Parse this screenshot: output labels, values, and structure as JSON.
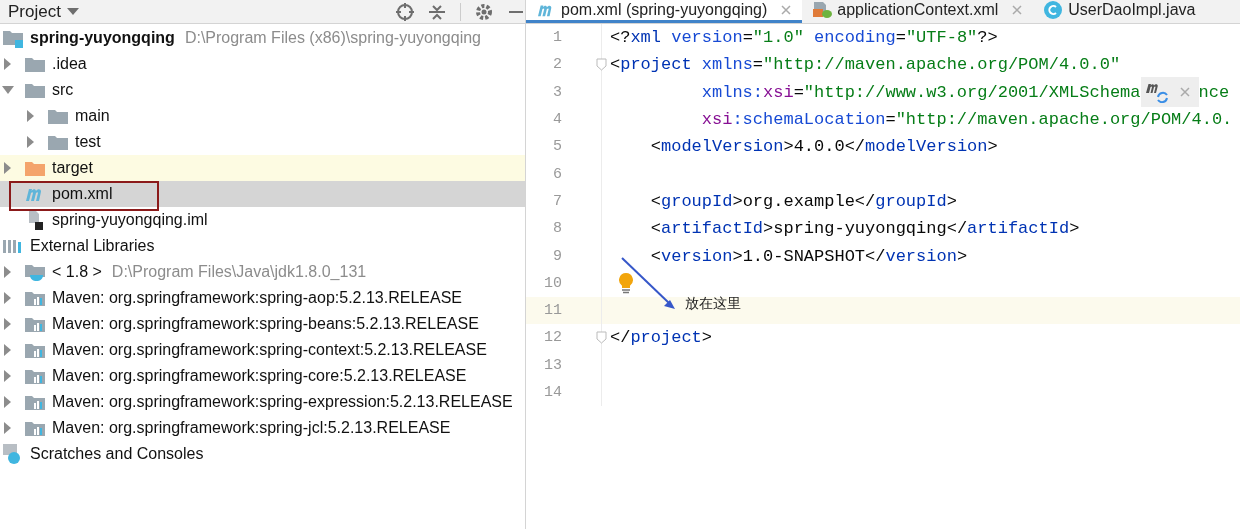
{
  "project_panel": {
    "title": "Project"
  },
  "tree": [
    {
      "label": "spring-yuyongqing",
      "kind": "module",
      "hint": "D:\\Program Files (x86)\\spring-yuyongqing",
      "selected": false,
      "children": [
        {
          "label": ".idea",
          "kind": "folder",
          "expanded": false,
          "selected": false
        },
        {
          "label": "src",
          "kind": "folder",
          "expanded": true,
          "selected": false,
          "children": [
            {
              "label": "main",
              "kind": "folder",
              "expanded": false,
              "selected": false
            },
            {
              "label": "test",
              "kind": "folder",
              "expanded": false,
              "selected": false
            }
          ]
        },
        {
          "label": "target",
          "kind": "excluded-folder",
          "expanded": false,
          "selected": false,
          "highlighted": true
        },
        {
          "label": "pom.xml",
          "kind": "maven",
          "selected": true,
          "outlined": true
        },
        {
          "label": "spring-yuyongqing.iml",
          "kind": "iml",
          "selected": false
        }
      ]
    },
    {
      "label": "External Libraries",
      "kind": "libraries",
      "selected": false,
      "children": [
        {
          "label": "< 1.8 >",
          "kind": "jdk",
          "hint": "D:\\Program Files\\Java\\jdk1.8.0_131",
          "expanded": false,
          "selected": false
        },
        {
          "label": "Maven: org.springframework:spring-aop:5.2.13.RELEASE",
          "kind": "library",
          "expanded": false,
          "selected": false
        },
        {
          "label": "Maven: org.springframework:spring-beans:5.2.13.RELEASE",
          "kind": "library",
          "expanded": false,
          "selected": false
        },
        {
          "label": "Maven: org.springframework:spring-context:5.2.13.RELEASE",
          "kind": "library",
          "expanded": false,
          "selected": false
        },
        {
          "label": "Maven: org.springframework:spring-core:5.2.13.RELEASE",
          "kind": "library",
          "expanded": false,
          "selected": false
        },
        {
          "label": "Maven: org.springframework:spring-expression:5.2.13.RELEASE",
          "kind": "library",
          "expanded": false,
          "selected": false
        },
        {
          "label": "Maven: org.springframework:spring-jcl:5.2.13.RELEASE",
          "kind": "library",
          "expanded": false,
          "selected": false
        }
      ]
    },
    {
      "label": "Scratches and Consoles",
      "kind": "scratches",
      "selected": false
    }
  ],
  "tabs": [
    {
      "label": "pom.xml (spring-yuyongqing)",
      "kind": "maven",
      "selected": true,
      "closable": true
    },
    {
      "label": "applicationContext.xml",
      "kind": "xml",
      "selected": false,
      "closable": true
    },
    {
      "label": "UserDaoImpl.java",
      "kind": "class",
      "selected": false,
      "closable": false
    }
  ],
  "editor": {
    "lines": [
      {
        "number": "1",
        "tokens": [
          {
            "kind": "punct",
            "text": "<?"
          },
          {
            "kind": "name",
            "text": "xml"
          },
          {
            "kind": "attr",
            "text": " version"
          },
          {
            "kind": "punct",
            "text": "="
          },
          {
            "kind": "value",
            "text": "\"1.0\""
          },
          {
            "kind": "attr",
            "text": " encoding"
          },
          {
            "kind": "punct",
            "text": "="
          },
          {
            "kind": "value",
            "text": "\"UTF-8\""
          },
          {
            "kind": "punct",
            "text": "?>"
          }
        ]
      },
      {
        "number": "2",
        "fold": true,
        "tokens": [
          {
            "kind": "punct",
            "text": "<"
          },
          {
            "kind": "name",
            "text": "project"
          },
          {
            "kind": "attr",
            "text": " xmlns"
          },
          {
            "kind": "punct",
            "text": "="
          },
          {
            "kind": "value",
            "text": "\"http://maven.apache.org/POM/4.0.0\""
          }
        ]
      },
      {
        "number": "3",
        "tokens": [
          {
            "kind": "attr",
            "text": "         xmlns:"
          },
          {
            "kind": "ns",
            "text": "xsi"
          },
          {
            "kind": "punct",
            "text": "="
          },
          {
            "kind": "value",
            "text": "\"http://www.w3.org/2001/XMLSchema"
          },
          {
            "kind": "popup"
          },
          {
            "kind": "value",
            "text": "nce"
          }
        ]
      },
      {
        "number": "4",
        "tokens": [
          {
            "kind": "ns",
            "text": "         xsi"
          },
          {
            "kind": "attr",
            "text": ":schemaLocation"
          },
          {
            "kind": "punct",
            "text": "="
          },
          {
            "kind": "value",
            "text": "\"http://maven.apache.org/POM/4.0."
          }
        ]
      },
      {
        "number": "5",
        "tokens": [
          {
            "kind": "punct",
            "text": "    <"
          },
          {
            "kind": "name",
            "text": "modelVersion"
          },
          {
            "kind": "punct",
            "text": ">4.0.0</"
          },
          {
            "kind": "name",
            "text": "modelVersion"
          },
          {
            "kind": "punct",
            "text": ">"
          }
        ]
      },
      {
        "number": "6"
      },
      {
        "number": "7",
        "tokens": [
          {
            "kind": "punct",
            "text": "    <"
          },
          {
            "kind": "name",
            "text": "groupId"
          },
          {
            "kind": "punct",
            "text": ">org.example</"
          },
          {
            "kind": "name",
            "text": "groupId"
          },
          {
            "kind": "punct",
            "text": ">"
          }
        ]
      },
      {
        "number": "8",
        "tokens": [
          {
            "kind": "punct",
            "text": "    <"
          },
          {
            "kind": "name",
            "text": "artifactId"
          },
          {
            "kind": "punct",
            "text": ">spring-yuyongqing</"
          },
          {
            "kind": "name",
            "text": "artifactId"
          },
          {
            "kind": "punct",
            "text": ">"
          }
        ]
      },
      {
        "number": "9",
        "tokens": [
          {
            "kind": "punct",
            "text": "    <"
          },
          {
            "kind": "name",
            "text": "version"
          },
          {
            "kind": "punct",
            "text": ">1.0-SNAPSHOT</"
          },
          {
            "kind": "name",
            "text": "version"
          },
          {
            "kind": "punct",
            "text": ">"
          }
        ]
      },
      {
        "number": "10",
        "bulb": true
      },
      {
        "number": "11",
        "current": true
      },
      {
        "number": "12",
        "fold": true,
        "tokens": [
          {
            "kind": "punct",
            "text": "</"
          },
          {
            "kind": "name",
            "text": "project"
          },
          {
            "kind": "punct",
            "text": ">"
          }
        ]
      },
      {
        "number": "13"
      },
      {
        "number": "14"
      }
    ]
  },
  "annotation": {
    "note": "放在这里"
  }
}
